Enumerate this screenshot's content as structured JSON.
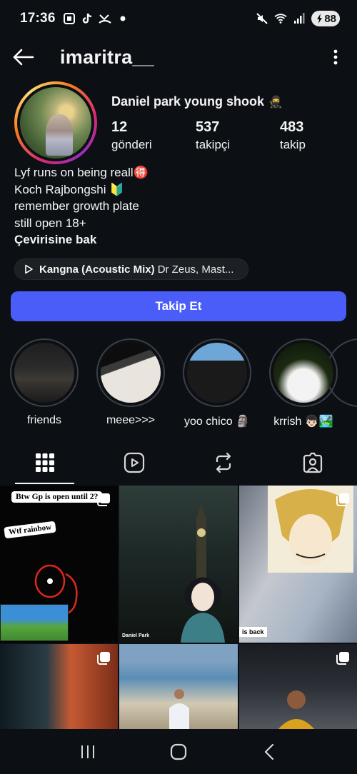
{
  "status_bar": {
    "time": "17:36",
    "battery": "88",
    "icons": [
      "screenshot-icon",
      "tiktok-icon",
      "missed-call-icon",
      "dot-icon",
      "mute-icon",
      "wifi-icon",
      "signal-icon",
      "battery-icon"
    ]
  },
  "header": {
    "username": "imaritra__",
    "back_icon": "back-arrow-icon",
    "more_icon": "more-vertical-icon"
  },
  "profile": {
    "display_name": "Daniel park young shook",
    "name_emoji": "🥷",
    "stats": [
      {
        "value": "12",
        "label": "gönderi"
      },
      {
        "value": "537",
        "label": "takipçi"
      },
      {
        "value": "483",
        "label": "takip"
      }
    ],
    "bio_lines": [
      "Lyf runs on being reall🉐",
      "Koch Rajbongshi 🔰",
      "remember growth plate",
      "still open 18+"
    ],
    "translate_label": "Çevirisine bak",
    "music": {
      "song": "Kangna (Acoustic Mix)",
      "artist": "Dr Zeus, Mast..."
    },
    "follow_label": "Takip Et"
  },
  "highlights": [
    {
      "label": "friends"
    },
    {
      "label": "meee>>>"
    },
    {
      "label": "yoo chico 🗿"
    },
    {
      "label": "krrish 👦🏻🏞️"
    }
  ],
  "tabs": [
    {
      "name": "posts",
      "icon": "grid-icon",
      "active": true
    },
    {
      "name": "reels",
      "icon": "reels-icon",
      "active": false
    },
    {
      "name": "reposts",
      "icon": "repost-icon",
      "active": false
    },
    {
      "name": "tagged",
      "icon": "tagged-icon",
      "active": false
    }
  ],
  "posts": [
    {
      "caption_1": "Btw Gp is open until 2?",
      "caption_2": "Wtf  rainbow",
      "multi": true
    },
    {
      "tag": "Daniel Park",
      "multi": false
    },
    {
      "tag": "is back",
      "multi": true
    },
    {
      "multi": true
    },
    {
      "multi": false
    },
    {
      "multi": true
    }
  ],
  "colors": {
    "background": "#0c1014",
    "follow_button": "#4a5df9",
    "text": "#f5f5f5"
  }
}
